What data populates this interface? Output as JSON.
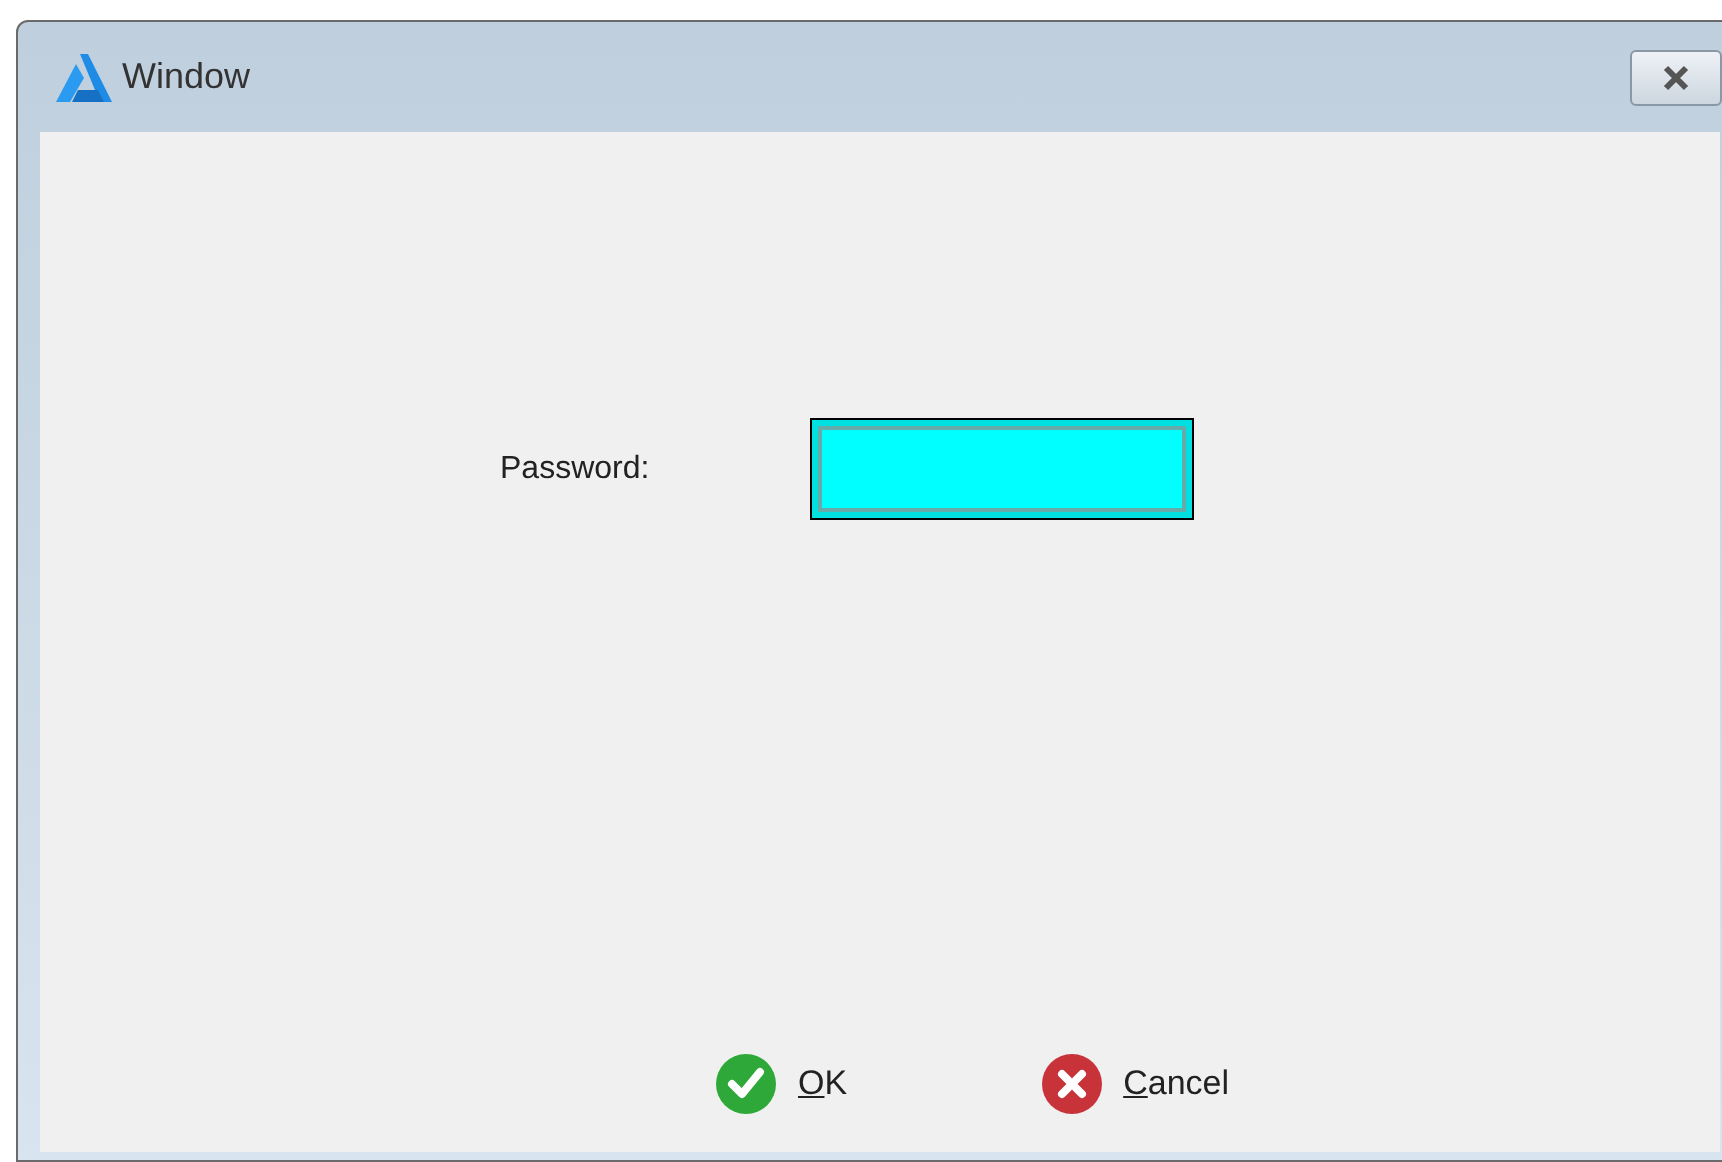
{
  "window": {
    "title": "Window"
  },
  "password": {
    "label": "Password:",
    "focused": true
  },
  "buttons": [
    {
      "label": "OK",
      "kind": "ok"
    },
    {
      "label": "Cancel",
      "kind": "cancel"
    }
  ]
}
